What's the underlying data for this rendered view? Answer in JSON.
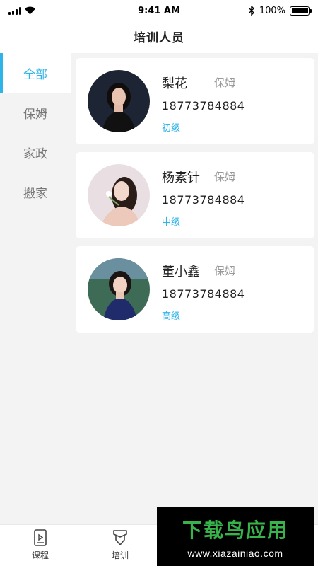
{
  "status_bar": {
    "time": "9:41 AM",
    "battery": "100%"
  },
  "header": {
    "title": "培训人员"
  },
  "sidebar": {
    "items": [
      {
        "label": "全部"
      },
      {
        "label": "保姆"
      },
      {
        "label": "家政"
      },
      {
        "label": "搬家"
      }
    ]
  },
  "trainees": [
    {
      "name": "梨花",
      "role": "保姆",
      "phone": "18773784884",
      "level": "初级"
    },
    {
      "name": "杨素针",
      "role": "保姆",
      "phone": "18773784884",
      "level": "中级"
    },
    {
      "name": "董小鑫",
      "role": "保姆",
      "phone": "18773784884",
      "level": "高级"
    }
  ],
  "tabs": [
    {
      "label": "课程",
      "icon": "course-book-icon"
    },
    {
      "label": "培训",
      "icon": "training-badge-icon"
    }
  ],
  "watermark": {
    "title": "下载鸟应用",
    "url": "www.xiazainiao.com"
  },
  "colors": {
    "accent": "#2fb4e8",
    "watermark_green": "#38b24a"
  }
}
